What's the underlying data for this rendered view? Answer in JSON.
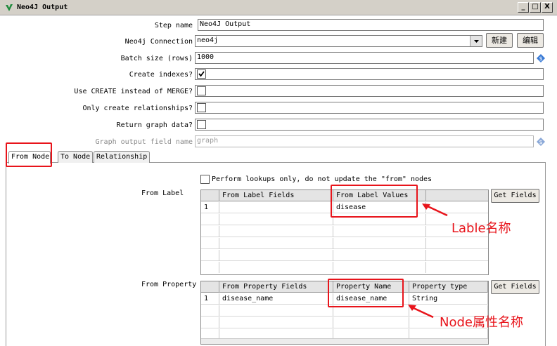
{
  "window": {
    "title": "Neo4J Output",
    "btn_min": "_",
    "btn_max": "□",
    "btn_close": "X"
  },
  "form": {
    "step_name_label": "Step name",
    "step_name_value": "Neo4J Output",
    "connection_label": "Neo4j Connection",
    "connection_value": "neo4j",
    "new_button": "新建",
    "edit_button": "编辑",
    "batch_size_label": "Batch size (rows)",
    "batch_size_value": "1000",
    "create_indexes_label": "Create indexes?",
    "use_create_label": "Use CREATE instead of MERGE?",
    "only_relationships_label": "Only create relationships?",
    "return_graph_label": "Return graph data?",
    "graph_output_label": "Graph output field name",
    "graph_output_placeholder": "graph"
  },
  "checkboxes": {
    "create_indexes": true,
    "use_create": false,
    "only_relationships": false,
    "return_graph": false,
    "lookups_only": false
  },
  "tabs": [
    {
      "label": "From Node",
      "active": true
    },
    {
      "label": "To Node",
      "active": false
    },
    {
      "label": "Relationship",
      "active": false
    }
  ],
  "from_node": {
    "lookups_label": "Perform lookups only, do not update the \"from\" nodes",
    "from_label_title": "From Label",
    "label_table": {
      "headers": [
        "From Label Fields",
        "From Label Values"
      ],
      "rows": [
        {
          "num": "1",
          "field": "",
          "value": "disease"
        }
      ]
    },
    "get_fields_1": "Get Fields",
    "from_property_title": "From Property",
    "property_table": {
      "headers": [
        "From Property Fields",
        "Property Name",
        "Property type"
      ],
      "rows": [
        {
          "num": "1",
          "field": "disease_name",
          "name": "disease_name",
          "type": "String"
        }
      ]
    },
    "get_fields_2": "Get Fields"
  },
  "annotations": {
    "label_note": "Lable名称",
    "property_note": "Node属性名称",
    "color": "#e8141b"
  }
}
